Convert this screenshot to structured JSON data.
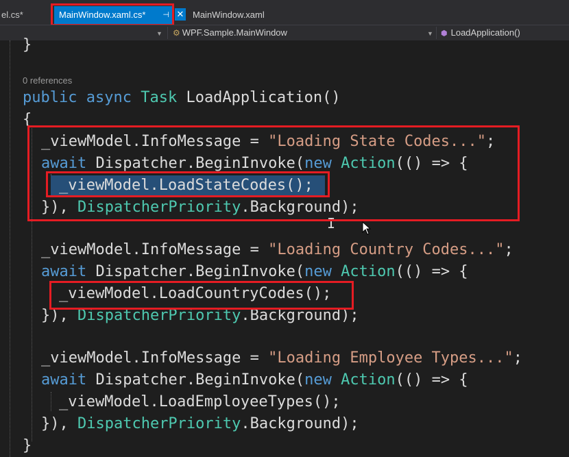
{
  "tabs": {
    "left_partial": "el.cs*",
    "active": "MainWindow.xaml.cs*",
    "active_pin": "⊣",
    "close": "✕",
    "xaml": "MainWindow.xaml"
  },
  "navbar": {
    "class_name": "WPF.Sample.MainWindow",
    "member_name": "LoadApplication()"
  },
  "code": {
    "prev_brace": "}",
    "codelens": "0 references",
    "line_sig_kw1": "public",
    "line_sig_kw2": "async",
    "line_sig_type": "Task",
    "line_sig_rest": " LoadApplication()",
    "open_brace": "{",
    "close_brace": "}",
    "block1": {
      "msg_pre": "_viewModel.InfoMessage = ",
      "msg_str": "\"Loading State Codes...\"",
      "msg_end": ";",
      "await_kw": "await",
      "dispatch": " Dispatcher.BeginInvoke(",
      "new_kw": "new",
      "action_type": "Action",
      "lambda": "(() => {",
      "call": "_viewModel.LoadStateCodes();",
      "close_pre": "}), ",
      "priority_type": "DispatcherPriority",
      "close_post": ".Background);"
    },
    "block2": {
      "msg_pre": "_viewModel.InfoMessage = ",
      "msg_str": "\"Loading Country Codes...\"",
      "msg_end": ";",
      "await_kw": "await",
      "dispatch": " Dispatcher.BeginInvoke(",
      "new_kw": "new",
      "action_type": "Action",
      "lambda": "(() => {",
      "call": "_viewModel.LoadCountryCodes();",
      "close_pre": "}), ",
      "priority_type": "DispatcherPriority",
      "close_post": ".Background);"
    },
    "block3": {
      "msg_pre": "_viewModel.InfoMessage = ",
      "msg_str": "\"Loading Employee Types...\"",
      "msg_end": ";",
      "await_kw": "await",
      "dispatch": " Dispatcher.BeginInvoke(",
      "new_kw": "new",
      "action_type": "Action",
      "lambda": "(() => {",
      "call": "_viewModel.LoadEmployeeTypes();",
      "close_pre": "}), ",
      "priority_type": "DispatcherPriority",
      "close_post": ".Background);"
    }
  },
  "colors": {
    "keyword": "#569cd6",
    "type": "#4ec9b0",
    "string": "#d69d85",
    "highlight_box": "#e51c23",
    "selection": "#264f78",
    "active_tab": "#007acc"
  }
}
